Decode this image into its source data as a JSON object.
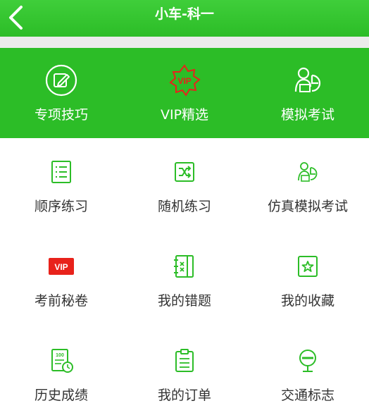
{
  "header": {
    "title": "小车-科一",
    "back_icon": "chevron-left-icon"
  },
  "features": [
    {
      "label": "专项技巧",
      "icon": "edit-icon"
    },
    {
      "label": "VIP精选",
      "icon": "vip-badge-icon"
    },
    {
      "label": "模拟考试",
      "icon": "exam-person-icon"
    }
  ],
  "grid": [
    {
      "label": "顺序练习",
      "icon": "list-icon"
    },
    {
      "label": "随机练习",
      "icon": "shuffle-icon"
    },
    {
      "label": "仿真模拟考试",
      "icon": "exam-person-icon"
    },
    {
      "label": "考前秘卷",
      "icon": "vip-tag-icon",
      "icon_text": "VIP"
    },
    {
      "label": "我的错题",
      "icon": "mistakes-book-icon"
    },
    {
      "label": "我的收藏",
      "icon": "star-icon"
    },
    {
      "label": "历史成绩",
      "icon": "history-score-icon",
      "icon_text": "100"
    },
    {
      "label": "我的订单",
      "icon": "order-icon"
    },
    {
      "label": "交通标志",
      "icon": "traffic-sign-icon"
    }
  ],
  "colors": {
    "primary": "#2cbd27",
    "vip_red": "#e8221b",
    "text": "#333333",
    "divider": "#ebebeb"
  }
}
